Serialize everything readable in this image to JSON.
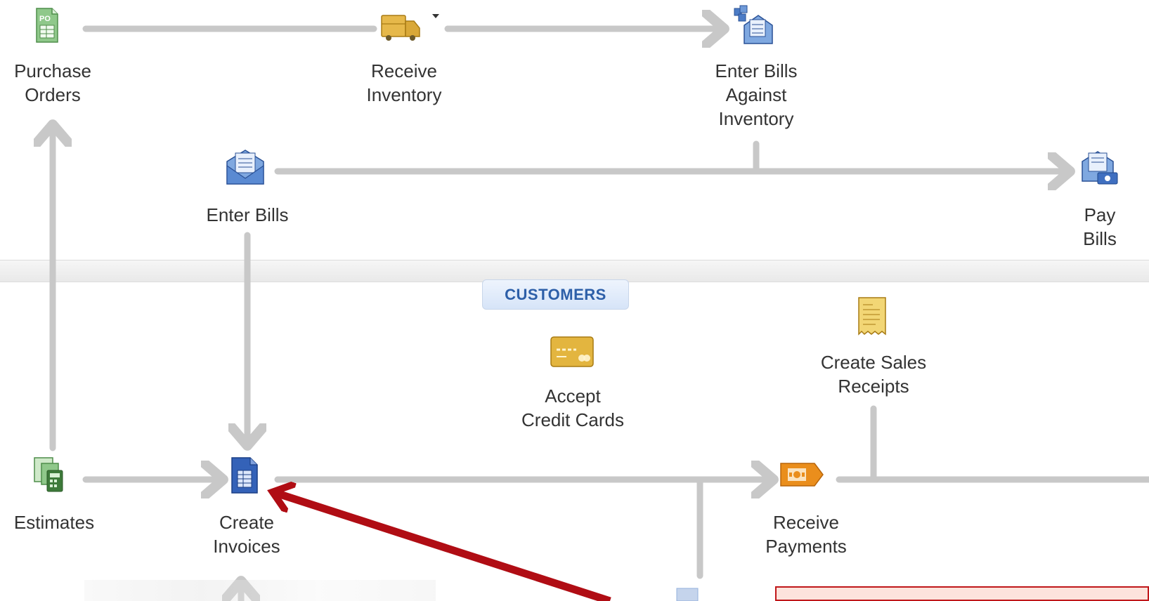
{
  "colors": {
    "flow_arrow": "#c8c8c8",
    "callout_arrow": "#b00d14",
    "divider_band": "#efefef",
    "section_pill_text": "#2d5fa8",
    "label_text": "#333333"
  },
  "vendors_flow": {
    "purchase_orders": {
      "label": "Purchase\nOrders",
      "icon": "purchase-order-icon"
    },
    "receive_inventory": {
      "label": "Receive\nInventory",
      "icon": "delivery-truck-icon"
    },
    "enter_bills_against_inventory": {
      "label": "Enter Bills\nAgainst\nInventory",
      "icon": "bills-against-inventory-icon"
    },
    "enter_bills": {
      "label": "Enter Bills",
      "icon": "enter-bills-icon"
    },
    "pay_bills": {
      "label": "Pay Bills",
      "icon": "pay-bills-icon"
    }
  },
  "customers_section": {
    "title": "CUSTOMERS",
    "accept_credit_cards": {
      "label": "Accept\nCredit Cards",
      "icon": "credit-card-icon"
    },
    "create_sales_receipts": {
      "label": "Create Sales\nReceipts",
      "icon": "sales-receipt-icon"
    },
    "estimates": {
      "label": "Estimates",
      "icon": "estimates-icon"
    },
    "create_invoices": {
      "label": "Create\nInvoices",
      "icon": "invoice-icon"
    },
    "receive_payments": {
      "label": "Receive\nPayments",
      "icon": "receive-payments-icon"
    }
  },
  "annotation": {
    "arrow_target": "Create Invoices",
    "callout_box": "callout-box"
  }
}
